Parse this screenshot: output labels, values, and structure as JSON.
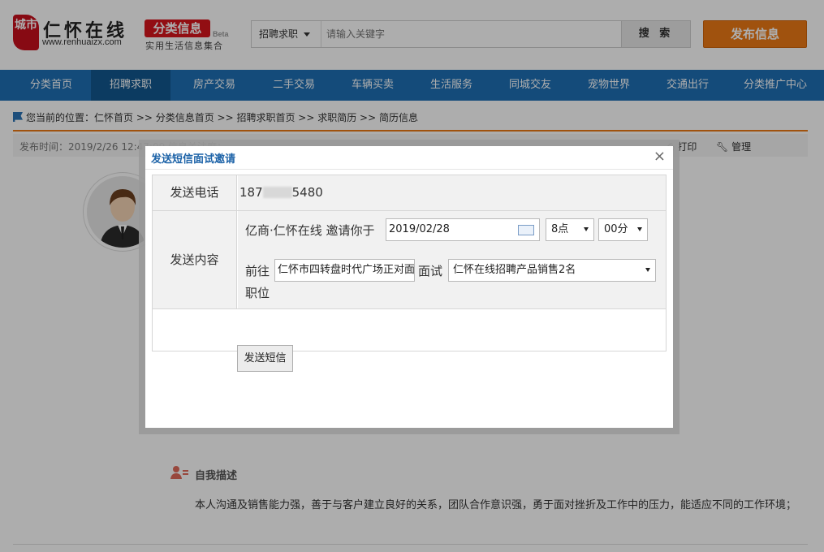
{
  "header": {
    "logo_seal": "城市",
    "logo_name": "仁怀在线",
    "logo_url": "www.renhuaizx.com",
    "category_badge": "分类信息",
    "beta": "Beta",
    "category_sub": "实用生活信息集合",
    "search": {
      "scope": "招聘求职",
      "placeholder": "请输入关键字",
      "button": "搜 索"
    },
    "publish_button": "发布信息"
  },
  "nav": {
    "items": [
      {
        "label": "分类首页",
        "active": false
      },
      {
        "label": "招聘求职",
        "active": true
      },
      {
        "label": "房产交易",
        "active": false
      },
      {
        "label": "二手交易",
        "active": false
      },
      {
        "label": "车辆买卖",
        "active": false
      },
      {
        "label": "生活服务",
        "active": false
      },
      {
        "label": "同城交友",
        "active": false
      },
      {
        "label": "宠物世界",
        "active": false
      },
      {
        "label": "交通出行",
        "active": false
      },
      {
        "label": "分类推广中心",
        "active": false
      }
    ]
  },
  "breadcrumb": "您当前的位置：仁怀首页 >> 分类信息首页 >> 招聘求职首页 >> 求职简历 >> 简历信息",
  "info_bar": {
    "publish_time": "发布时间：2019/2/26 12:47:09  信息关注度：",
    "tools": {
      "print": "打印",
      "manage": "管理"
    }
  },
  "self_intro": {
    "title": "自我描述",
    "text": "本人沟通及销售能力强，善于与客户建立良好的关系，团队合作意识强，勇于面对挫折及工作中的压力，能适应不同的工作环境；"
  },
  "dialog": {
    "title": "发送短信面试邀请",
    "close": "×",
    "phone_label": "发送电话",
    "phone_prefix": "187",
    "phone_suffix": "5480",
    "content_label": "发送内容",
    "invite_text": "亿商·仁怀在线 邀请你于",
    "date_value": "2019/02/28",
    "hour_value": "8点",
    "minute_value": "00分",
    "goto_text": "前往",
    "address_value": "仁怀市四转盘时代广场正对面",
    "interview_text": "面试",
    "position_value": "仁怀在线招聘产品销售2名",
    "position_suffix": "职位",
    "send_button": "发送短信"
  },
  "colors": {
    "nav_bg": "#1e6fb4",
    "nav_active": "#12578f",
    "brand_red": "#d8161d",
    "publish_orange": "#ec7a16",
    "dialog_title": "#1d63a8"
  }
}
